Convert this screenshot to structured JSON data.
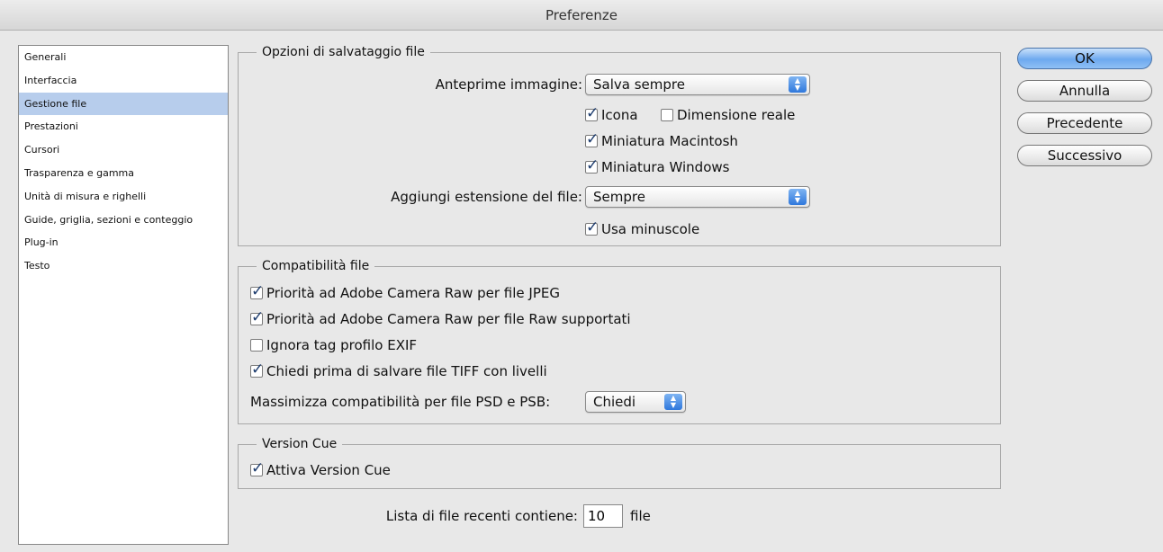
{
  "window": {
    "title": "Preferenze"
  },
  "sidebar": {
    "items": [
      {
        "label": "Generali"
      },
      {
        "label": "Interfaccia"
      },
      {
        "label": "Gestione file"
      },
      {
        "label": "Prestazioni"
      },
      {
        "label": "Cursori"
      },
      {
        "label": "Trasparenza e gamma"
      },
      {
        "label": "Unità di misura e righelli"
      },
      {
        "label": "Guide, griglia, sezioni e conteggio"
      },
      {
        "label": "Plug-in"
      },
      {
        "label": "Testo"
      }
    ],
    "selected": "Gestione file"
  },
  "save_options": {
    "legend": "Opzioni di salvataggio file",
    "previews_label": "Anteprime immagine:",
    "previews_value": "Salva sempre",
    "icona": {
      "label": "Icona",
      "checked": true
    },
    "full_size": {
      "label": "Dimensione reale",
      "checked": false
    },
    "mac_thumb": {
      "label": "Miniatura Macintosh",
      "checked": true
    },
    "win_thumb": {
      "label": "Miniatura Windows",
      "checked": true
    },
    "ext_label": "Aggiungi estensione del file:",
    "ext_value": "Sempre",
    "lowercase": {
      "label": "Usa minuscole",
      "checked": true
    }
  },
  "compat": {
    "legend": "Compatibilità file",
    "jpeg": {
      "label": "Priorità ad Adobe Camera Raw per file JPEG",
      "checked": true
    },
    "raw": {
      "label": "Priorità ad Adobe Camera Raw per file Raw supportati",
      "checked": true
    },
    "exif": {
      "label": "Ignora tag profilo EXIF",
      "checked": false
    },
    "tiff": {
      "label": "Chiedi prima di salvare file TIFF con livelli",
      "checked": true
    },
    "max_label": "Massimizza compatibilità per file PSD e PSB:",
    "max_value": "Chiedi"
  },
  "version_cue": {
    "legend": "Version Cue",
    "enable": {
      "label": "Attiva Version Cue",
      "checked": true
    }
  },
  "recent": {
    "label": "Lista di file recenti contiene:",
    "value": "10",
    "suffix": "file"
  },
  "buttons": {
    "ok": "OK",
    "cancel": "Annulla",
    "prev": "Precedente",
    "next": "Successivo"
  },
  "icons": {
    "popup_arrows": "updown-arrows-icon",
    "check": "checkmark-icon"
  },
  "colors": {
    "selection": "#b7cdec",
    "primary_button": "#6ea9ef",
    "popup_arrow": "#2f78dc"
  }
}
